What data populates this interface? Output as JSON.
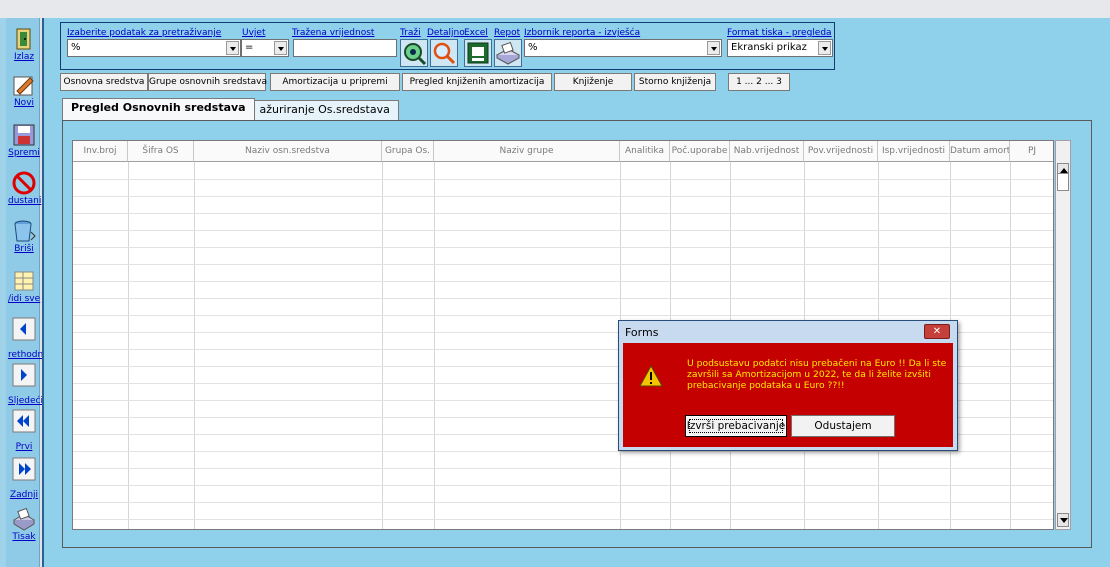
{
  "sidebar": {
    "buttons": [
      {
        "label": "Izlaz",
        "icon": "exit-door-icon"
      },
      {
        "label": "Novi",
        "icon": "new-pencil-icon"
      },
      {
        "label": "Spremi",
        "icon": "save-icon"
      },
      {
        "label": "dustani",
        "icon": "cancel-icon"
      },
      {
        "label": "Briši",
        "icon": "trash-icon"
      },
      {
        "label": "/idi sve",
        "icon": "view-all-icon"
      },
      {
        "label": "rethodni",
        "icon": "previous-arrow-icon"
      },
      {
        "label": "Sljedeći",
        "icon": "next-arrow-icon"
      },
      {
        "label": "Prvi",
        "icon": "first-double-arrow-icon"
      },
      {
        "label": "Zadnji",
        "icon": "last-double-arrow-icon"
      },
      {
        "label": "Tisak",
        "icon": "print-icon"
      }
    ]
  },
  "search": {
    "field_label": "Izaberite podatak za pretraživanje",
    "field_value": "%",
    "condition_label": "Uvjet",
    "condition_value": "=",
    "value_label": "Tražena vrijednost",
    "value_value": "",
    "search_label": "Traži",
    "detail_label": "Detaljno",
    "excel_label": "Excel",
    "report_label": "Repot",
    "report_select_label": "Izbornik  reporta - izvješća",
    "report_select_value": "%",
    "print_format_label": "Format tiska - pregleda",
    "print_format_value": "Ekranski prikaz"
  },
  "nav_buttons": [
    "Osnovna sredstva",
    "Grupe osnovnih sredstava",
    "Amortizacija u pripremi",
    "Pregled knjiženih amortizacija",
    "Knjiženje",
    "Storno knjiženja",
    "1 ... 2 ... 3"
  ],
  "tabs": [
    {
      "label": "Pregled Osnovnih sredstava",
      "active": true
    },
    {
      "label": "Unos i ažuriranje Os.sredstava",
      "active": false
    }
  ],
  "grid": {
    "columns": [
      "Inv.broj",
      "Šifra OS",
      "Naziv osn.sredstva",
      "Grupa Os.",
      "Naziv grupe",
      "Analitika",
      "Poč.uporabe",
      "Nab.vrijednost",
      "Pov.vrijednosti",
      "Isp.vrijednosti",
      "Datum amort",
      "PJ"
    ]
  },
  "dialog": {
    "title": "Forms",
    "close_glyph": "✕",
    "message": "U podsustavu podatci nisu prebačeni na Euro !!  Da li ste završili sa Amortizacijom u 2022, te da li želite izvšiti prebacivanje podataka u Euro ??!!",
    "confirm_label": "Izvrši prebacivanje",
    "cancel_label": "Odustajem"
  },
  "colors": {
    "app_background": "#8fd0ea",
    "dialog_body": "#c40000",
    "dialog_text": "#ffeb00",
    "link_blue": "#0000c8"
  }
}
